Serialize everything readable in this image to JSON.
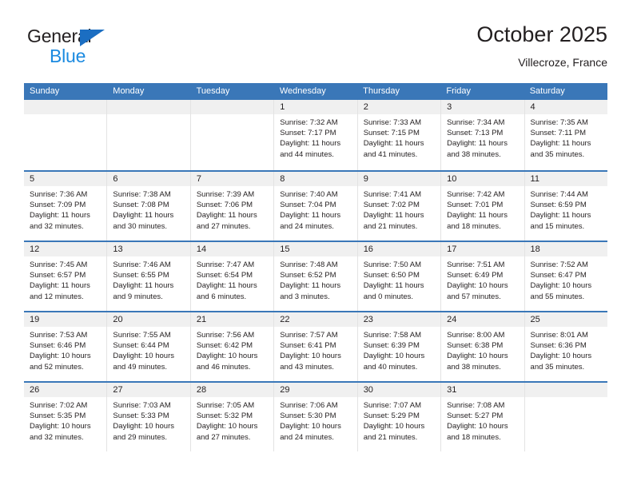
{
  "brand": {
    "name_top": "General",
    "name_bottom": "Blue",
    "triangle_color": "#1b6ec2",
    "blue_text_color": "#1b8ae0"
  },
  "header": {
    "title": "October 2025",
    "subtitle": "Villecroze, France"
  },
  "theme": {
    "header_bar": "#3a77b8",
    "daynum_band": "#f0f0f0",
    "cell_divider": "#e3e3e3",
    "text": "#231f20"
  },
  "weekdays": [
    "Sunday",
    "Monday",
    "Tuesday",
    "Wednesday",
    "Thursday",
    "Friday",
    "Saturday"
  ],
  "weeks": [
    [
      {
        "day": "",
        "sunrise": "",
        "sunset": "",
        "daylight_1": "",
        "daylight_2": "",
        "empty": true
      },
      {
        "day": "",
        "sunrise": "",
        "sunset": "",
        "daylight_1": "",
        "daylight_2": "",
        "empty": true
      },
      {
        "day": "",
        "sunrise": "",
        "sunset": "",
        "daylight_1": "",
        "daylight_2": "",
        "empty": true
      },
      {
        "day": "1",
        "sunrise": "Sunrise: 7:32 AM",
        "sunset": "Sunset: 7:17 PM",
        "daylight_1": "Daylight: 11 hours",
        "daylight_2": "and 44 minutes."
      },
      {
        "day": "2",
        "sunrise": "Sunrise: 7:33 AM",
        "sunset": "Sunset: 7:15 PM",
        "daylight_1": "Daylight: 11 hours",
        "daylight_2": "and 41 minutes."
      },
      {
        "day": "3",
        "sunrise": "Sunrise: 7:34 AM",
        "sunset": "Sunset: 7:13 PM",
        "daylight_1": "Daylight: 11 hours",
        "daylight_2": "and 38 minutes."
      },
      {
        "day": "4",
        "sunrise": "Sunrise: 7:35 AM",
        "sunset": "Sunset: 7:11 PM",
        "daylight_1": "Daylight: 11 hours",
        "daylight_2": "and 35 minutes."
      }
    ],
    [
      {
        "day": "5",
        "sunrise": "Sunrise: 7:36 AM",
        "sunset": "Sunset: 7:09 PM",
        "daylight_1": "Daylight: 11 hours",
        "daylight_2": "and 32 minutes."
      },
      {
        "day": "6",
        "sunrise": "Sunrise: 7:38 AM",
        "sunset": "Sunset: 7:08 PM",
        "daylight_1": "Daylight: 11 hours",
        "daylight_2": "and 30 minutes."
      },
      {
        "day": "7",
        "sunrise": "Sunrise: 7:39 AM",
        "sunset": "Sunset: 7:06 PM",
        "daylight_1": "Daylight: 11 hours",
        "daylight_2": "and 27 minutes."
      },
      {
        "day": "8",
        "sunrise": "Sunrise: 7:40 AM",
        "sunset": "Sunset: 7:04 PM",
        "daylight_1": "Daylight: 11 hours",
        "daylight_2": "and 24 minutes."
      },
      {
        "day": "9",
        "sunrise": "Sunrise: 7:41 AM",
        "sunset": "Sunset: 7:02 PM",
        "daylight_1": "Daylight: 11 hours",
        "daylight_2": "and 21 minutes."
      },
      {
        "day": "10",
        "sunrise": "Sunrise: 7:42 AM",
        "sunset": "Sunset: 7:01 PM",
        "daylight_1": "Daylight: 11 hours",
        "daylight_2": "and 18 minutes."
      },
      {
        "day": "11",
        "sunrise": "Sunrise: 7:44 AM",
        "sunset": "Sunset: 6:59 PM",
        "daylight_1": "Daylight: 11 hours",
        "daylight_2": "and 15 minutes."
      }
    ],
    [
      {
        "day": "12",
        "sunrise": "Sunrise: 7:45 AM",
        "sunset": "Sunset: 6:57 PM",
        "daylight_1": "Daylight: 11 hours",
        "daylight_2": "and 12 minutes."
      },
      {
        "day": "13",
        "sunrise": "Sunrise: 7:46 AM",
        "sunset": "Sunset: 6:55 PM",
        "daylight_1": "Daylight: 11 hours",
        "daylight_2": "and 9 minutes."
      },
      {
        "day": "14",
        "sunrise": "Sunrise: 7:47 AM",
        "sunset": "Sunset: 6:54 PM",
        "daylight_1": "Daylight: 11 hours",
        "daylight_2": "and 6 minutes."
      },
      {
        "day": "15",
        "sunrise": "Sunrise: 7:48 AM",
        "sunset": "Sunset: 6:52 PM",
        "daylight_1": "Daylight: 11 hours",
        "daylight_2": "and 3 minutes."
      },
      {
        "day": "16",
        "sunrise": "Sunrise: 7:50 AM",
        "sunset": "Sunset: 6:50 PM",
        "daylight_1": "Daylight: 11 hours",
        "daylight_2": "and 0 minutes."
      },
      {
        "day": "17",
        "sunrise": "Sunrise: 7:51 AM",
        "sunset": "Sunset: 6:49 PM",
        "daylight_1": "Daylight: 10 hours",
        "daylight_2": "and 57 minutes."
      },
      {
        "day": "18",
        "sunrise": "Sunrise: 7:52 AM",
        "sunset": "Sunset: 6:47 PM",
        "daylight_1": "Daylight: 10 hours",
        "daylight_2": "and 55 minutes."
      }
    ],
    [
      {
        "day": "19",
        "sunrise": "Sunrise: 7:53 AM",
        "sunset": "Sunset: 6:46 PM",
        "daylight_1": "Daylight: 10 hours",
        "daylight_2": "and 52 minutes."
      },
      {
        "day": "20",
        "sunrise": "Sunrise: 7:55 AM",
        "sunset": "Sunset: 6:44 PM",
        "daylight_1": "Daylight: 10 hours",
        "daylight_2": "and 49 minutes."
      },
      {
        "day": "21",
        "sunrise": "Sunrise: 7:56 AM",
        "sunset": "Sunset: 6:42 PM",
        "daylight_1": "Daylight: 10 hours",
        "daylight_2": "and 46 minutes."
      },
      {
        "day": "22",
        "sunrise": "Sunrise: 7:57 AM",
        "sunset": "Sunset: 6:41 PM",
        "daylight_1": "Daylight: 10 hours",
        "daylight_2": "and 43 minutes."
      },
      {
        "day": "23",
        "sunrise": "Sunrise: 7:58 AM",
        "sunset": "Sunset: 6:39 PM",
        "daylight_1": "Daylight: 10 hours",
        "daylight_2": "and 40 minutes."
      },
      {
        "day": "24",
        "sunrise": "Sunrise: 8:00 AM",
        "sunset": "Sunset: 6:38 PM",
        "daylight_1": "Daylight: 10 hours",
        "daylight_2": "and 38 minutes."
      },
      {
        "day": "25",
        "sunrise": "Sunrise: 8:01 AM",
        "sunset": "Sunset: 6:36 PM",
        "daylight_1": "Daylight: 10 hours",
        "daylight_2": "and 35 minutes."
      }
    ],
    [
      {
        "day": "26",
        "sunrise": "Sunrise: 7:02 AM",
        "sunset": "Sunset: 5:35 PM",
        "daylight_1": "Daylight: 10 hours",
        "daylight_2": "and 32 minutes."
      },
      {
        "day": "27",
        "sunrise": "Sunrise: 7:03 AM",
        "sunset": "Sunset: 5:33 PM",
        "daylight_1": "Daylight: 10 hours",
        "daylight_2": "and 29 minutes."
      },
      {
        "day": "28",
        "sunrise": "Sunrise: 7:05 AM",
        "sunset": "Sunset: 5:32 PM",
        "daylight_1": "Daylight: 10 hours",
        "daylight_2": "and 27 minutes."
      },
      {
        "day": "29",
        "sunrise": "Sunrise: 7:06 AM",
        "sunset": "Sunset: 5:30 PM",
        "daylight_1": "Daylight: 10 hours",
        "daylight_2": "and 24 minutes."
      },
      {
        "day": "30",
        "sunrise": "Sunrise: 7:07 AM",
        "sunset": "Sunset: 5:29 PM",
        "daylight_1": "Daylight: 10 hours",
        "daylight_2": "and 21 minutes."
      },
      {
        "day": "31",
        "sunrise": "Sunrise: 7:08 AM",
        "sunset": "Sunset: 5:27 PM",
        "daylight_1": "Daylight: 10 hours",
        "daylight_2": "and 18 minutes."
      },
      {
        "day": "",
        "sunrise": "",
        "sunset": "",
        "daylight_1": "",
        "daylight_2": "",
        "empty": true
      }
    ]
  ]
}
